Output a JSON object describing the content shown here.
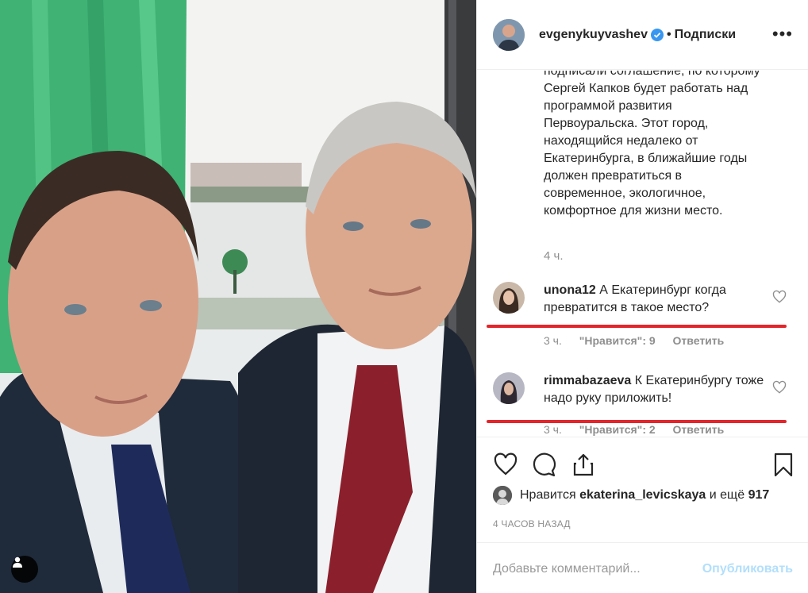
{
  "post": {
    "author": {
      "username": "evgenykuyvashev",
      "verified": true,
      "follow_label": "Подписки",
      "separator": "•"
    },
    "more_menu_icon": "more-horizontal-icon",
    "caption": {
      "lines": [
        "подписали соглашение, по которому",
        "Сергей Капков будет работать над",
        "программой развития",
        "Первоуральска. Этот город,",
        "находящийся недалеко от",
        "Екатеринбурга, в ближайшие годы",
        "должен превратиться в",
        "современное, экологичное,",
        "комфортное для жизни место."
      ],
      "time": "4 ч."
    },
    "comments": [
      {
        "user": "unona12",
        "text": "А Екатеринбург когда превратится в такое место?",
        "time": "3 ч.",
        "likes": "\"Нравится\": 9",
        "reply": "Ответить"
      },
      {
        "user": "rimmabazaeva",
        "text": "К Екатеринбургу тоже надо руку приложить!",
        "time": "3 ч.",
        "likes": "\"Нравится\": 2",
        "reply": "Ответить"
      }
    ],
    "actions": {
      "like_icon": "heart-outline-icon",
      "comment_icon": "comment-bubble-icon",
      "share_icon": "share-upload-icon",
      "save_icon": "bookmark-icon"
    },
    "likes_summary": {
      "prefix": "Нравится",
      "user": "ekaterina_levicskaya",
      "middle": "и ещё",
      "count": "917"
    },
    "posted_time": "4 ЧАСОВ НАЗАД",
    "comment_input": {
      "placeholder": "Добавьте комментарий...",
      "value": ""
    },
    "publish_label": "Опубликовать",
    "colors": {
      "verified_blue": "#3897f0",
      "annotation_red": "#e2262b",
      "publish_disabled": "#b2dffc",
      "muted_text": "#8e8e8e"
    }
  }
}
